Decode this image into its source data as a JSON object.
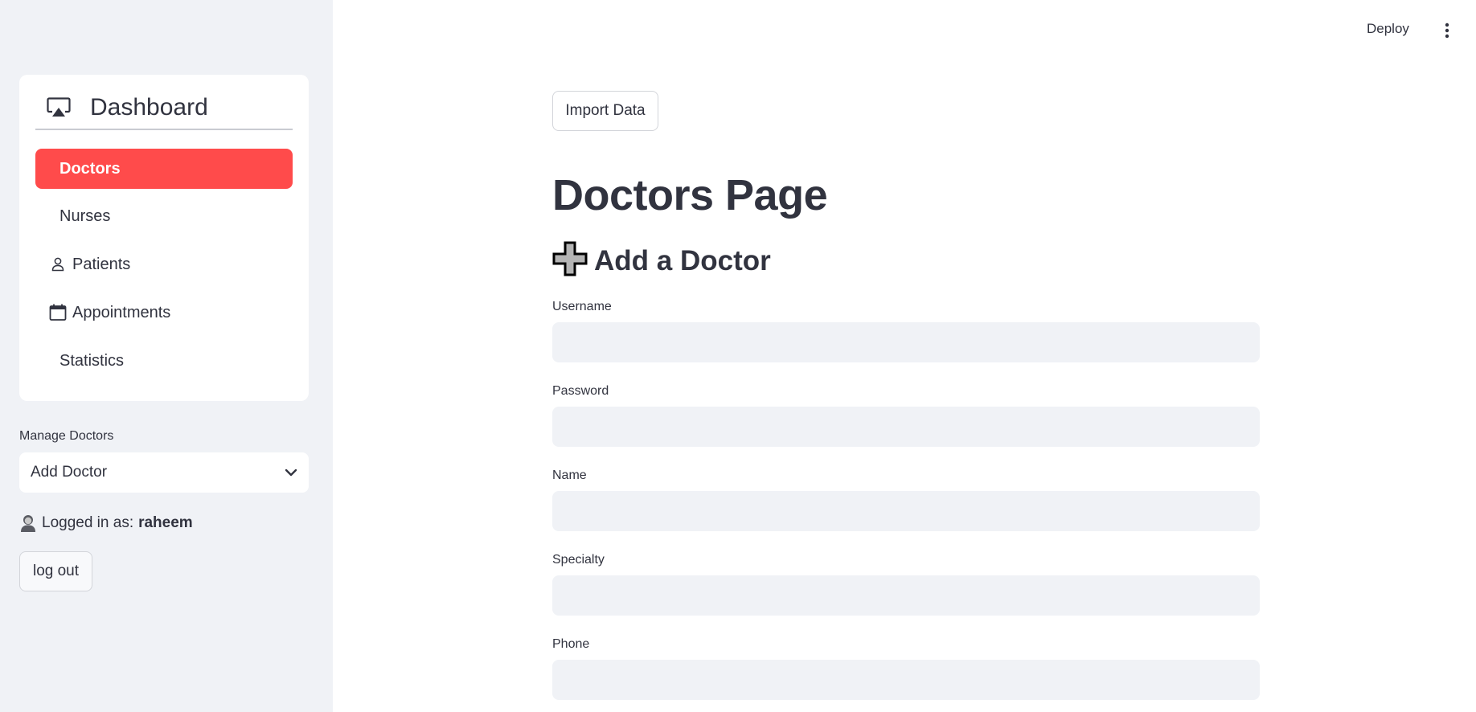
{
  "header": {
    "deploy_label": "Deploy",
    "menu_icon": "kebab-menu-icon"
  },
  "sidebar": {
    "nav_title": "Dashboard",
    "nav_title_icon": "airplay-icon",
    "items": [
      {
        "label": "Doctors",
        "icon": null,
        "active": true
      },
      {
        "label": "Nurses",
        "icon": null,
        "active": false
      },
      {
        "label": "Patients",
        "icon": "person-icon",
        "active": false
      },
      {
        "label": "Appointments",
        "icon": "calendar-icon",
        "active": false
      },
      {
        "label": "Statistics",
        "icon": null,
        "active": false
      }
    ],
    "manage_label": "Manage Doctors",
    "manage_selected": "Add Doctor",
    "logged_in_prefix": "Logged in as:",
    "logged_in_user": "raheem",
    "logout_label": "log out"
  },
  "main": {
    "import_label": "Import Data",
    "page_title": "Doctors Page",
    "section_title": "Add a Doctor",
    "section_icon": "plus-icon",
    "fields": [
      {
        "label": "Username",
        "value": ""
      },
      {
        "label": "Password",
        "value": ""
      },
      {
        "label": "Name",
        "value": ""
      },
      {
        "label": "Specialty",
        "value": ""
      },
      {
        "label": "Phone",
        "value": ""
      }
    ]
  },
  "colors": {
    "accent": "#ff4b4b",
    "sidebar_bg": "#f0f2f6",
    "input_bg": "#f0f2f6",
    "text": "#31333f"
  }
}
